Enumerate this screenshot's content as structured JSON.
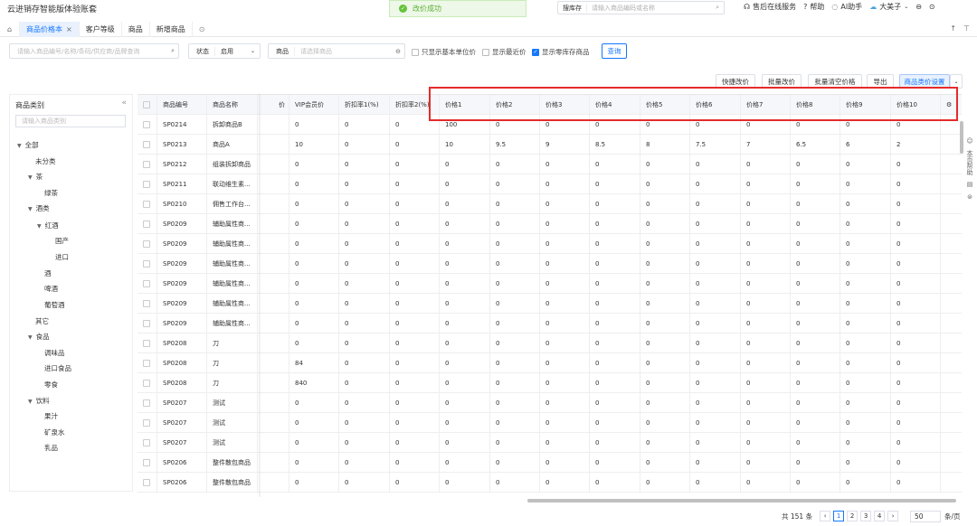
{
  "app_title": "云进销存智能版体验账套",
  "toast": {
    "text": "改价成功",
    "icon": "check-icon"
  },
  "global_search": {
    "label": "搜库存",
    "placeholder": "请输入商品编码或名称",
    "icon": "search-icon"
  },
  "top_links": {
    "service": "售后在线服务",
    "help": "帮助",
    "ai": "AI助手",
    "user": "大美子"
  },
  "tabs": [
    {
      "label": "商品价格本",
      "active": true,
      "closable": true
    },
    {
      "label": "客户等级",
      "active": false
    },
    {
      "label": "商品",
      "active": false
    },
    {
      "label": "新增商品",
      "active": false
    }
  ],
  "filters": {
    "keyword_placeholder": "请输入商品编号/名称/条码/供应商/品牌查询",
    "status_label": "状态",
    "status_value": "启用",
    "product_label": "商品",
    "product_placeholder": "请选择商品",
    "only_base_unit": "只显示基本单位价",
    "show_recent": "显示最近价",
    "show_zero_stock": "显示零库存商品",
    "query_button": "查询"
  },
  "toolbar": {
    "quick_edit": "快捷改价",
    "batch_edit": "批量改价",
    "batch_clear": "批量清空价格",
    "export": "导出",
    "settings": "商品类价设置"
  },
  "sidebar": {
    "title": "商品类别",
    "search_placeholder": "请输入商品类别",
    "tree": [
      {
        "label": "全部",
        "level": 0,
        "arrow": true
      },
      {
        "label": "未分类",
        "level": 1,
        "arrow": false
      },
      {
        "label": "茶",
        "level": 1,
        "arrow": true
      },
      {
        "label": "绿茶",
        "level": 2,
        "arrow": false
      },
      {
        "label": "酒类",
        "level": 1,
        "arrow": true
      },
      {
        "label": "红酒",
        "level": 2,
        "arrow": true
      },
      {
        "label": "国产",
        "level": 3,
        "arrow": false
      },
      {
        "label": "进口",
        "level": 3,
        "arrow": false
      },
      {
        "label": "酒",
        "level": 2,
        "arrow": false
      },
      {
        "label": "啤酒",
        "level": 2,
        "arrow": false
      },
      {
        "label": "葡萄酒",
        "level": 2,
        "arrow": false
      },
      {
        "label": "其它",
        "level": 1,
        "arrow": false
      },
      {
        "label": "食品",
        "level": 1,
        "arrow": true
      },
      {
        "label": "调味品",
        "level": 2,
        "arrow": false
      },
      {
        "label": "进口食品",
        "level": 2,
        "arrow": false
      },
      {
        "label": "零食",
        "level": 2,
        "arrow": false
      },
      {
        "label": "饮料",
        "level": 1,
        "arrow": true
      },
      {
        "label": "果汁",
        "level": 2,
        "arrow": false
      },
      {
        "label": "矿泉水",
        "level": 2,
        "arrow": false
      },
      {
        "label": "乳品",
        "level": 2,
        "arrow": false
      }
    ]
  },
  "table": {
    "columns": [
      "商品编号",
      "商品名称",
      "价",
      "VIP会员价",
      "折扣率1(%)",
      "折扣率2(%)",
      "价格1",
      "价格2",
      "价格3",
      "价格4",
      "价格5",
      "价格6",
      "价格7",
      "价格8",
      "价格9",
      "价格10"
    ],
    "rows": [
      [
        "SP0214",
        "拆卸商品B",
        "",
        "0",
        "0",
        "0",
        "100",
        "0",
        "0",
        "0",
        "0",
        "0",
        "0",
        "0",
        "0",
        "0"
      ],
      [
        "SP0213",
        "商品A",
        "",
        "10",
        "0",
        "0",
        "10",
        "9.5",
        "9",
        "8.5",
        "8",
        "7.5",
        "7",
        "6.5",
        "6",
        "2"
      ],
      [
        "SP0212",
        "组装拆卸商品",
        "",
        "0",
        "0",
        "0",
        "0",
        "0",
        "0",
        "0",
        "0",
        "0",
        "0",
        "0",
        "0",
        "0"
      ],
      [
        "SP0211",
        "联动维生素...",
        "",
        "0",
        "0",
        "0",
        "0",
        "0",
        "0",
        "0",
        "0",
        "0",
        "0",
        "0",
        "0",
        "0"
      ],
      [
        "SP0210",
        "佣售工作台...",
        "",
        "0",
        "0",
        "0",
        "0",
        "0",
        "0",
        "0",
        "0",
        "0",
        "0",
        "0",
        "0",
        "0"
      ],
      [
        "SP0209",
        "辅助属性商...",
        "",
        "0",
        "0",
        "0",
        "0",
        "0",
        "0",
        "0",
        "0",
        "0",
        "0",
        "0",
        "0",
        "0"
      ],
      [
        "SP0209",
        "辅助属性商...",
        "",
        "0",
        "0",
        "0",
        "0",
        "0",
        "0",
        "0",
        "0",
        "0",
        "0",
        "0",
        "0",
        "0"
      ],
      [
        "SP0209",
        "辅助属性商...",
        "",
        "0",
        "0",
        "0",
        "0",
        "0",
        "0",
        "0",
        "0",
        "0",
        "0",
        "0",
        "0",
        "0"
      ],
      [
        "SP0209",
        "辅助属性商...",
        "",
        "0",
        "0",
        "0",
        "0",
        "0",
        "0",
        "0",
        "0",
        "0",
        "0",
        "0",
        "0",
        "0"
      ],
      [
        "SP0209",
        "辅助属性商...",
        "",
        "0",
        "0",
        "0",
        "0",
        "0",
        "0",
        "0",
        "0",
        "0",
        "0",
        "0",
        "0",
        "0"
      ],
      [
        "SP0209",
        "辅助属性商...",
        "",
        "0",
        "0",
        "0",
        "0",
        "0",
        "0",
        "0",
        "0",
        "0",
        "0",
        "0",
        "0",
        "0"
      ],
      [
        "SP0208",
        "刀",
        "",
        "0",
        "0",
        "0",
        "0",
        "0",
        "0",
        "0",
        "0",
        "0",
        "0",
        "0",
        "0",
        "0"
      ],
      [
        "SP0208",
        "刀",
        "",
        "84",
        "0",
        "0",
        "0",
        "0",
        "0",
        "0",
        "0",
        "0",
        "0",
        "0",
        "0",
        "0"
      ],
      [
        "SP0208",
        "刀",
        "",
        "840",
        "0",
        "0",
        "0",
        "0",
        "0",
        "0",
        "0",
        "0",
        "0",
        "0",
        "0",
        "0"
      ],
      [
        "SP0207",
        "测试",
        "",
        "0",
        "0",
        "0",
        "0",
        "0",
        "0",
        "0",
        "0",
        "0",
        "0",
        "0",
        "0",
        "0"
      ],
      [
        "SP0207",
        "测试",
        "",
        "0",
        "0",
        "0",
        "0",
        "0",
        "0",
        "0",
        "0",
        "0",
        "0",
        "0",
        "0",
        "0"
      ],
      [
        "SP0207",
        "测试",
        "",
        "0",
        "0",
        "0",
        "0",
        "0",
        "0",
        "0",
        "0",
        "0",
        "0",
        "0",
        "0",
        "0"
      ],
      [
        "SP0206",
        "整件散包商品",
        "",
        "0",
        "0",
        "0",
        "0",
        "0",
        "0",
        "0",
        "0",
        "0",
        "0",
        "0",
        "0",
        "0"
      ],
      [
        "SP0206",
        "整件散包商品",
        "",
        "0",
        "0",
        "0",
        "0",
        "0",
        "0",
        "0",
        "0",
        "0",
        "0",
        "0",
        "0",
        "0"
      ]
    ]
  },
  "pagination": {
    "total": "共 151 条",
    "pages": [
      "1",
      "2",
      "3",
      "4"
    ],
    "current": "1",
    "page_size": "50",
    "per_page": "条/页"
  },
  "side_tools": {
    "help_label": "本页帮助"
  }
}
